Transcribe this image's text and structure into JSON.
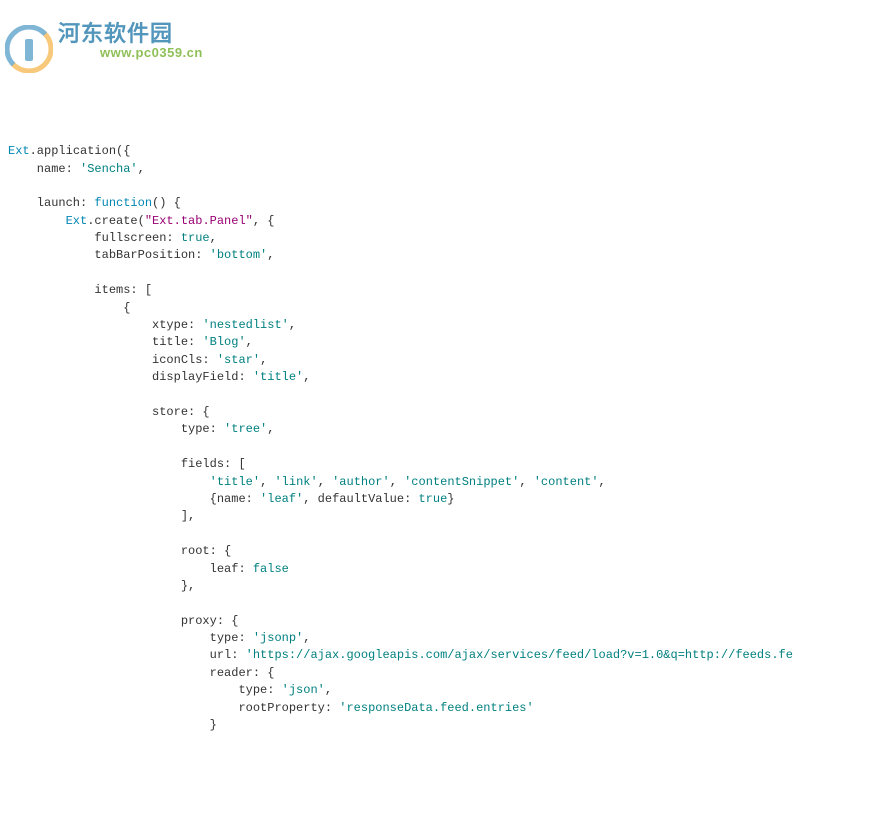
{
  "watermark": {
    "text": "河东软件园",
    "url": "www.pc0359.cn"
  },
  "code": {
    "l1a": "Ext",
    "l1b": ".application({",
    "l2a": "    name: ",
    "l2b": "'Sencha'",
    "l2c": ",",
    "l3": " ",
    "l4a": "    launch: ",
    "l4b": "function",
    "l4c": "() {",
    "l5a": "        Ext",
    "l5b": ".create(",
    "l5c": "\"Ext.tab.Panel\"",
    "l5d": ", {",
    "l6a": "            fullscreen: ",
    "l6b": "true",
    "l6c": ",",
    "l7a": "            tabBarPosition: ",
    "l7b": "'bottom'",
    "l7c": ",",
    "l8": " ",
    "l9": "            items: [",
    "l10": "                {",
    "l11a": "                    xtype: ",
    "l11b": "'nestedlist'",
    "l11c": ",",
    "l12a": "                    title: ",
    "l12b": "'Blog'",
    "l12c": ",",
    "l13a": "                    iconCls: ",
    "l13b": "'star'",
    "l13c": ",",
    "l14a": "                    displayField: ",
    "l14b": "'title'",
    "l14c": ",",
    "l15": " ",
    "l16": "                    store: {",
    "l17a": "                        type: ",
    "l17b": "'tree'",
    "l17c": ",",
    "l18": " ",
    "l19": "                        fields: [",
    "l20a": "                            ",
    "l20b": "'title'",
    "l20c": ", ",
    "l20d": "'link'",
    "l20e": ", ",
    "l20f": "'author'",
    "l20g": ", ",
    "l20h": "'contentSnippet'",
    "l20i": ", ",
    "l20j": "'content'",
    "l20k": ",",
    "l21a": "                            {name: ",
    "l21b": "'leaf'",
    "l21c": ", defaultValue: ",
    "l21d": "true",
    "l21e": "}",
    "l22": "                        ],",
    "l23": " ",
    "l24": "                        root: {",
    "l25a": "                            leaf: ",
    "l25b": "false",
    "l26": "                        },",
    "l27": " ",
    "l28": "                        proxy: {",
    "l29a": "                            type: ",
    "l29b": "'jsonp'",
    "l29c": ",",
    "l30a": "                            url: ",
    "l30b": "'https://ajax.googleapis.com/ajax/services/feed/load?v=1.0&q=http://feeds.fe",
    "l31": "                            reader: {",
    "l32a": "                                type: ",
    "l32b": "'json'",
    "l32c": ",",
    "l33a": "                                rootProperty: ",
    "l33b": "'responseData.feed.entries'",
    "l34": "                            }"
  }
}
